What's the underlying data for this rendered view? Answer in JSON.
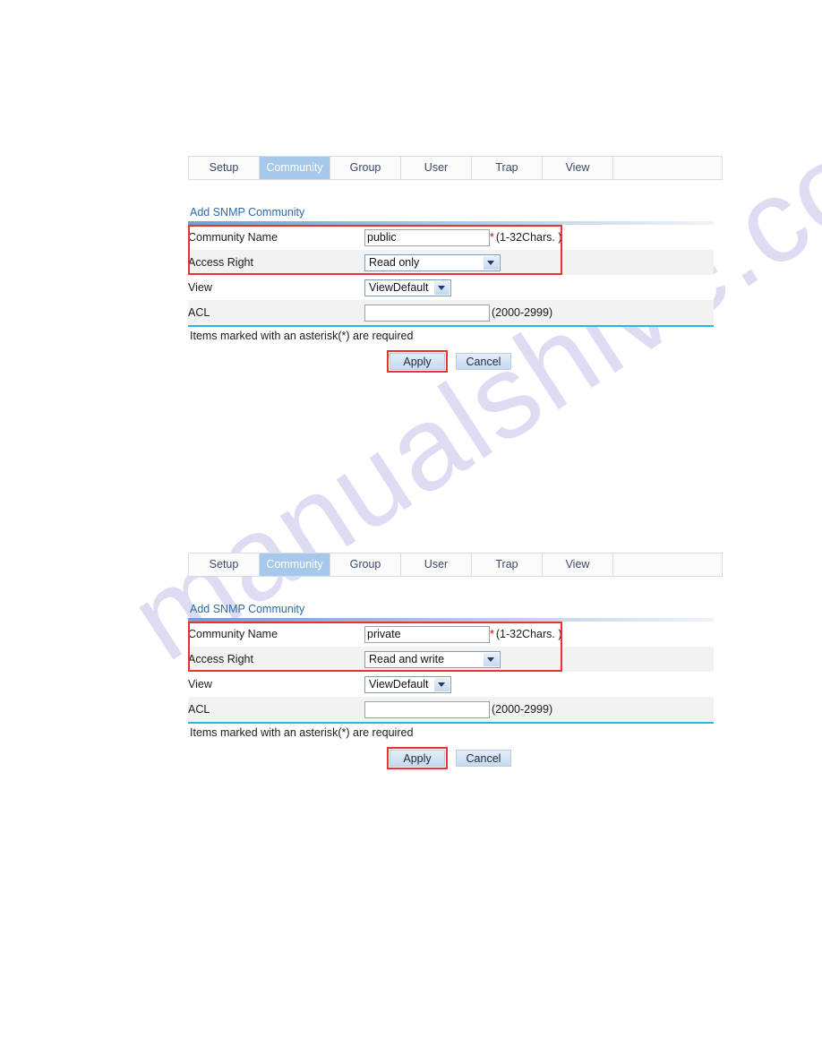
{
  "watermark": {
    "text": "manualshive.com"
  },
  "tabs": {
    "items": [
      {
        "label": "Setup",
        "active": false
      },
      {
        "label": "Community",
        "active": true
      },
      {
        "label": "Group",
        "active": false
      },
      {
        "label": "User",
        "active": false
      },
      {
        "label": "Trap",
        "active": false
      },
      {
        "label": "View",
        "active": false
      }
    ]
  },
  "colors": {
    "active_tab_bg": "#a6c8ea",
    "title_text": "#2f6aa8",
    "highlight_border": "#e8342a",
    "required_star": "#d00000",
    "bottom_rule": "#29b6e8",
    "row_alt_bg": "#f2f2f2"
  },
  "section_one": {
    "title": "Add SNMP Community",
    "fields": {
      "community_name": {
        "label": "Community Name",
        "value": "public",
        "placeholder": "",
        "star": "*",
        "hint": "(1-32Chars. )"
      },
      "access_right": {
        "label": "Access Right",
        "value": "Read only",
        "options": [
          "Read only",
          "Read and write"
        ]
      },
      "view": {
        "label": "View",
        "value": "ViewDefault",
        "options": [
          "ViewDefault"
        ]
      },
      "acl": {
        "label": "ACL",
        "value": "",
        "placeholder": "",
        "hint": "(2000-2999)"
      }
    },
    "note": "Items marked with an asterisk(*) are required",
    "buttons": {
      "apply": "Apply",
      "cancel": "Cancel"
    }
  },
  "section_two": {
    "title": "Add SNMP Community",
    "fields": {
      "community_name": {
        "label": "Community Name",
        "value": "private",
        "placeholder": "",
        "star": "*",
        "hint": "(1-32Chars. )"
      },
      "access_right": {
        "label": "Access Right",
        "value": "Read and write",
        "options": [
          "Read only",
          "Read and write"
        ]
      },
      "view": {
        "label": "View",
        "value": "ViewDefault",
        "options": [
          "ViewDefault"
        ]
      },
      "acl": {
        "label": "ACL",
        "value": "",
        "placeholder": "",
        "hint": "(2000-2999)"
      }
    },
    "note": "Items marked with an asterisk(*) are required",
    "buttons": {
      "apply": "Apply",
      "cancel": "Cancel"
    }
  }
}
